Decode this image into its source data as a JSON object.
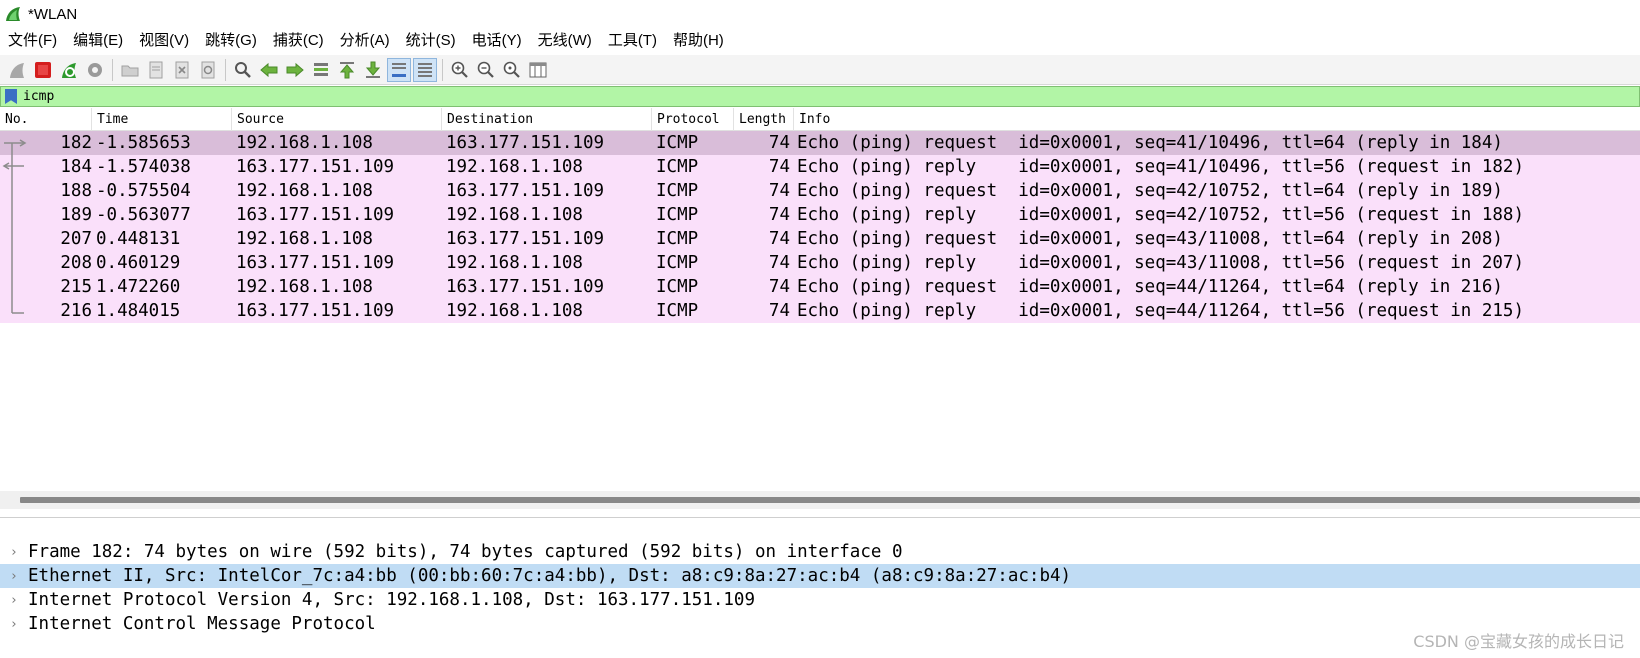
{
  "window": {
    "title": "*WLAN"
  },
  "menu": [
    "文件(F)",
    "编辑(E)",
    "视图(V)",
    "跳转(G)",
    "捕获(C)",
    "分析(A)",
    "统计(S)",
    "电话(Y)",
    "无线(W)",
    "工具(T)",
    "帮助(H)"
  ],
  "toolbar": {
    "icons": [
      "shark-fin-start-icon",
      "stop-capture-icon",
      "restart-capture-icon",
      "capture-options-icon",
      "open-file-icon",
      "save-file-icon",
      "close-file-icon",
      "reload-file-icon",
      "find-packet-icon",
      "go-back-icon",
      "go-forward-icon",
      "go-to-packet-icon",
      "first-packet-icon",
      "last-packet-icon",
      "autoscroll-icon",
      "colorize-icon",
      "zoom-in-icon",
      "zoom-out-icon",
      "zoom-reset-icon",
      "resize-columns-icon"
    ]
  },
  "filter": {
    "value": "icmp"
  },
  "packet_list": {
    "columns": [
      "No.",
      "Time",
      "Source",
      "Destination",
      "Protocol",
      "Length",
      "Info"
    ],
    "rows": [
      {
        "no": "182",
        "time": "-1.585653",
        "src": "192.168.1.108",
        "dst": "163.177.151.109",
        "proto": "ICMP",
        "len": "74",
        "info": "Echo (ping) request  id=0x0001, seq=41/10496, ttl=64 (reply in 184)"
      },
      {
        "no": "184",
        "time": "-1.574038",
        "src": "163.177.151.109",
        "dst": "192.168.1.108",
        "proto": "ICMP",
        "len": "74",
        "info": "Echo (ping) reply    id=0x0001, seq=41/10496, ttl=56 (request in 182)"
      },
      {
        "no": "188",
        "time": "-0.575504",
        "src": "192.168.1.108",
        "dst": "163.177.151.109",
        "proto": "ICMP",
        "len": "74",
        "info": "Echo (ping) request  id=0x0001, seq=42/10752, ttl=64 (reply in 189)"
      },
      {
        "no": "189",
        "time": "-0.563077",
        "src": "163.177.151.109",
        "dst": "192.168.1.108",
        "proto": "ICMP",
        "len": "74",
        "info": "Echo (ping) reply    id=0x0001, seq=42/10752, ttl=56 (request in 188)"
      },
      {
        "no": "207",
        "time": "0.448131",
        "src": "192.168.1.108",
        "dst": "163.177.151.109",
        "proto": "ICMP",
        "len": "74",
        "info": "Echo (ping) request  id=0x0001, seq=43/11008, ttl=64 (reply in 208)"
      },
      {
        "no": "208",
        "time": "0.460129",
        "src": "163.177.151.109",
        "dst": "192.168.1.108",
        "proto": "ICMP",
        "len": "74",
        "info": "Echo (ping) reply    id=0x0001, seq=43/11008, ttl=56 (request in 207)"
      },
      {
        "no": "215",
        "time": "1.472260",
        "src": "192.168.1.108",
        "dst": "163.177.151.109",
        "proto": "ICMP",
        "len": "74",
        "info": "Echo (ping) request  id=0x0001, seq=44/11264, ttl=64 (reply in 216)"
      },
      {
        "no": "216",
        "time": "1.484015",
        "src": "163.177.151.109",
        "dst": "192.168.1.108",
        "proto": "ICMP",
        "len": "74",
        "info": "Echo (ping) reply    id=0x0001, seq=44/11264, ttl=56 (request in 215)"
      }
    ]
  },
  "details": [
    "Frame 182: 74 bytes on wire (592 bits), 74 bytes captured (592 bits) on interface 0",
    "Ethernet II, Src: IntelCor_7c:a4:bb (00:bb:60:7c:a4:bb), Dst: a8:c9:8a:27:ac:b4 (a8:c9:8a:27:ac:b4)",
    "Internet Protocol Version 4, Src: 192.168.1.108, Dst: 163.177.151.109",
    "Internet Control Message Protocol"
  ],
  "watermark": "CSDN @宝藏女孩的成长日记",
  "colors": {
    "row_bg": "#fae0fa",
    "row_selected": "#d9bdd9",
    "filter_bg": "#b2f5a6",
    "detail_selected": "#c0dcf4"
  }
}
